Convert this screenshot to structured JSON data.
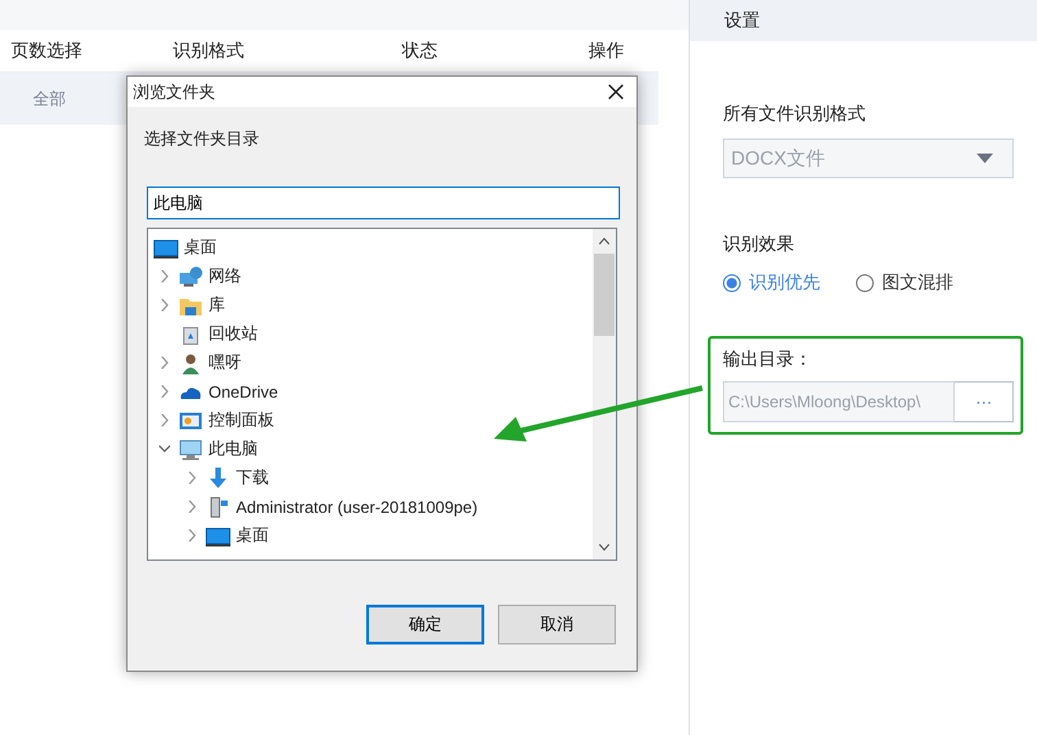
{
  "table": {
    "columns": [
      "页数选择",
      "识别格式",
      "状态",
      "操作"
    ],
    "rows": [
      {
        "cells": [
          "全部"
        ]
      }
    ]
  },
  "dialog": {
    "title": "浏览文件夹",
    "instruction": "选择文件夹目录",
    "path": "此电脑",
    "tree": [
      {
        "label": "桌面",
        "kind": "desktop",
        "expandable": false,
        "children": [
          {
            "label": "网络",
            "kind": "network",
            "expandable": true,
            "expanded": false
          },
          {
            "label": "库",
            "kind": "library",
            "expandable": true,
            "expanded": false
          },
          {
            "label": "回收站",
            "kind": "recycle",
            "expandable": false
          },
          {
            "label": "嘿呀",
            "kind": "user",
            "expandable": true,
            "expanded": false
          },
          {
            "label": "OneDrive",
            "kind": "cloud",
            "expandable": true,
            "expanded": false
          },
          {
            "label": "控制面板",
            "kind": "panel",
            "expandable": true,
            "expanded": false
          },
          {
            "label": "此电脑",
            "kind": "computer",
            "expandable": true,
            "expanded": true,
            "children": [
              {
                "label": "下载",
                "kind": "download",
                "expandable": true,
                "expanded": false
              },
              {
                "label": "Administrator (user-20181009pe)",
                "kind": "drive",
                "expandable": true,
                "expanded": false
              },
              {
                "label": "桌面",
                "kind": "desktop",
                "expandable": true,
                "expanded": false
              }
            ]
          }
        ]
      }
    ],
    "buttons": [
      {
        "label": "确定",
        "selected": true
      },
      {
        "label": "取消",
        "selected": false
      }
    ]
  },
  "settings": {
    "title": "设置",
    "format_label": "所有文件识别格式",
    "format_value": "DOCX文件",
    "effect_label": "识别效果",
    "effects": [
      {
        "label": "识别优先",
        "selected": true
      },
      {
        "label": "图文混排",
        "selected": false
      }
    ],
    "output_label": "输出目录：",
    "output_path": "C:\\Users\\Mloong\\Desktop\\",
    "browse": "···"
  }
}
